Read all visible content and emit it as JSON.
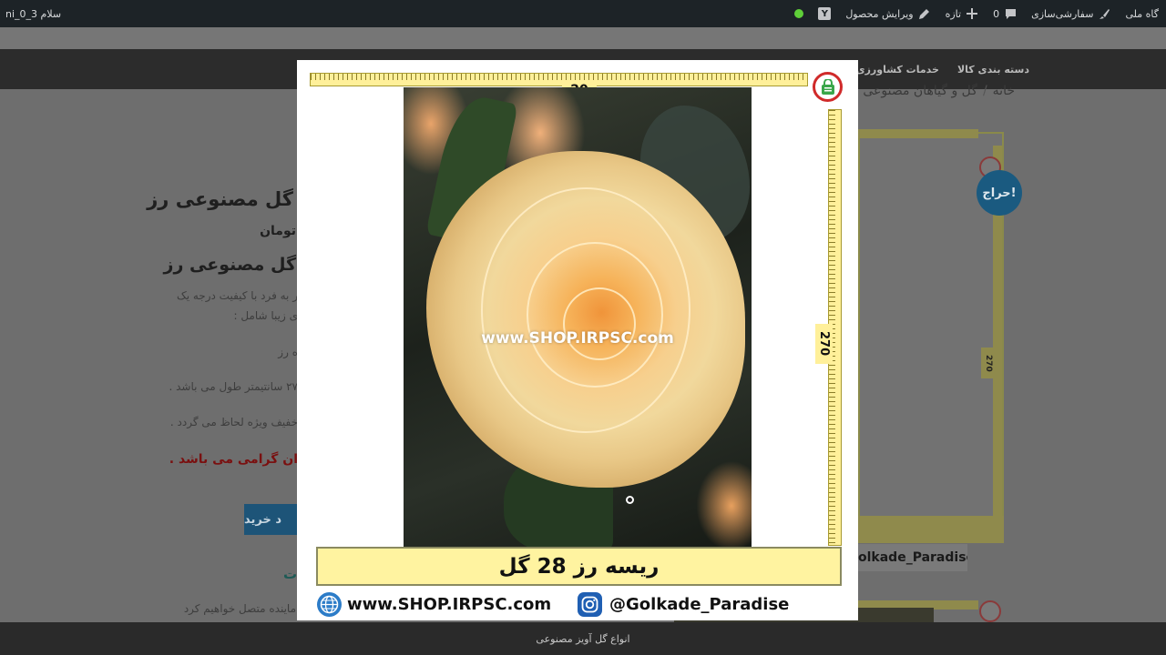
{
  "admin_bar": {
    "site_name_fragment": "گاه ملی",
    "customize": "سفارشی‌سازی",
    "comments_count": "0",
    "new": "تازه",
    "edit_product": "ویرایش محصول",
    "greeting": "سلام ni_0_3"
  },
  "nav": {
    "items": [
      "دسته بندی کالا",
      "خدمات کشاورزی"
    ]
  },
  "breadcrumb": {
    "home": "خانه",
    "category": "گل و گیاهان مصنوعی"
  },
  "product": {
    "title_fragment": "گل مصنوعی رز",
    "price_fragment": "تومان",
    "subtitle_fragment": "گل مصنوعی رز",
    "desc_lines": [
      "ر به فرد با کیفیت درجه یک",
      "ی زیبا شامل :",
      "ه رز",
      "۲۷ سانتیمتر طول می باشد .",
      "خفیف ویژه لحاظ می گردد ."
    ],
    "notice_fragment": "ان گرامی می باشد .",
    "buy_button_fragment": "د خرید",
    "contact_fragment": "ماینده متصل خواهیم کرد",
    "teal_fragment": "ت"
  },
  "gallery": {
    "sale_badge": "حراج!",
    "ruler_label": "270",
    "caption_fragment": "olkade_Paradise"
  },
  "bottom_bar": {
    "text": "انواع گل آویز مصنوعی"
  },
  "lightbox": {
    "ruler_top_label": "20",
    "ruler_side_label": "270",
    "watermark": "www.SHOP.IRPSC.com",
    "caption": "ریسه رز 28 گل",
    "website": "www.SHOP.IRPSC.com",
    "instagram": "@Golkade_Paradise"
  },
  "colors": {
    "admin_bar": "#1d2327",
    "ruler_yellow": "#fff09a",
    "sale_badge": "#1a5a80",
    "status_dot": "#5fcf39"
  }
}
